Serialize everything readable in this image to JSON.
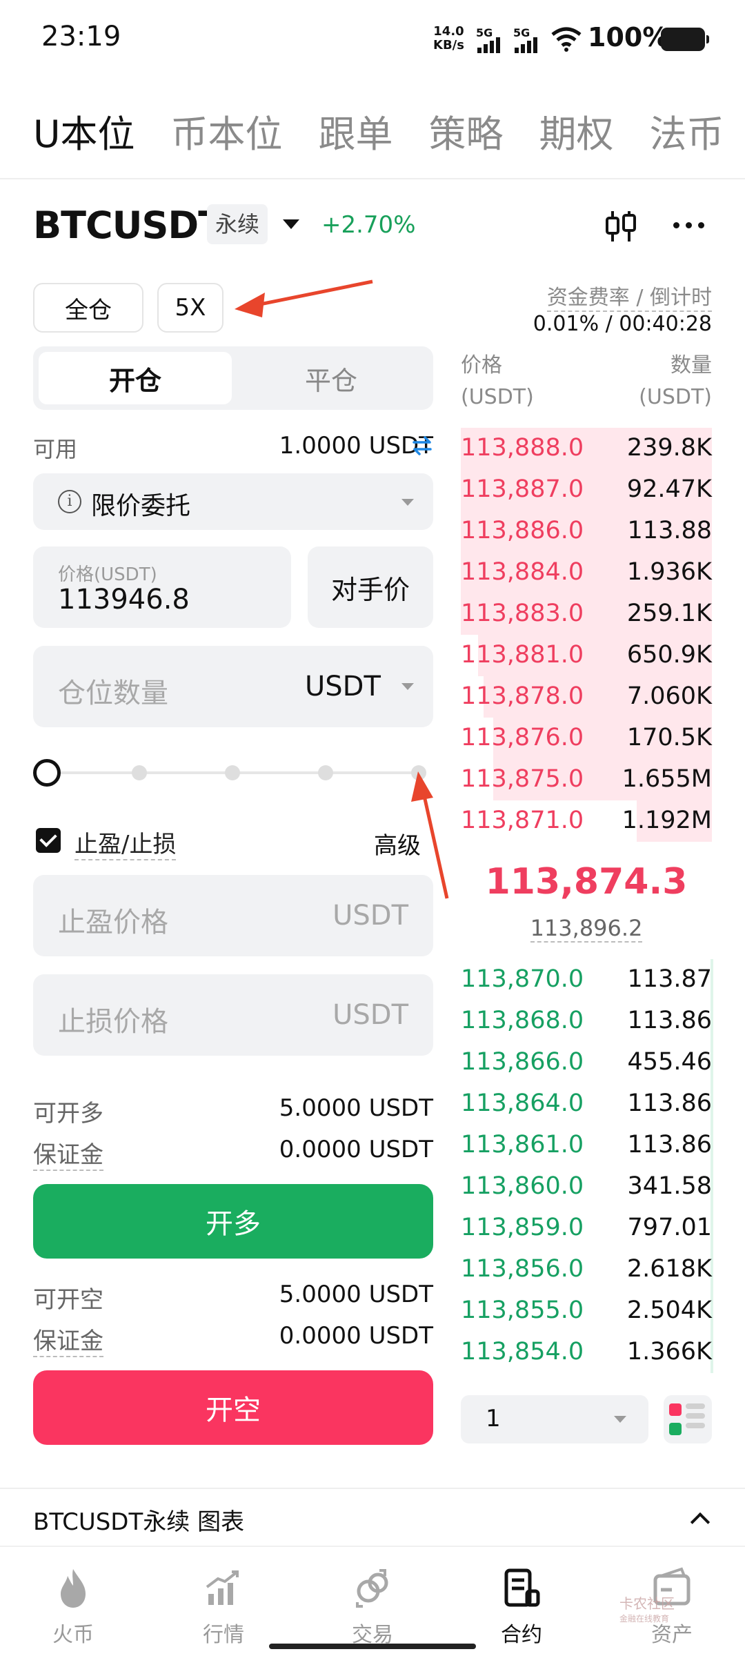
{
  "status_bar": {
    "time": "23:19",
    "net_speed": "14.0",
    "net_unit": "KB/s",
    "sim1": "5G",
    "sim2": "5G",
    "battery": "100%"
  },
  "top_tabs": [
    "U本位",
    "币本位",
    "跟单",
    "策略",
    "期权",
    "法币"
  ],
  "pair": {
    "symbol": "BTCUSDT",
    "type": "永续",
    "change": "+2.70%"
  },
  "margin": {
    "mode": "全仓",
    "leverage": "5X"
  },
  "funding": {
    "label": "资金费率 / 倒计时",
    "value": "0.01% / 00:40:28"
  },
  "order_side": {
    "open": "开仓",
    "close": "平仓"
  },
  "available": {
    "label": "可用",
    "value": "1.0000 USDT"
  },
  "order_type": "限价委托",
  "price": {
    "label": "价格(USDT)",
    "value": "113946.8",
    "counter": "对手价"
  },
  "quantity": {
    "placeholder": "仓位数量",
    "unit": "USDT"
  },
  "slider": {
    "value": 0
  },
  "tpsl": {
    "label": "止盈/止损",
    "checked": true,
    "advanced": "高级",
    "tp_placeholder": "止盈价格",
    "sl_placeholder": "止损价格",
    "unit": "USDT"
  },
  "long": {
    "max_label": "可开多",
    "max_value": "5.0000 USDT",
    "margin_label": "保证金",
    "margin_value": "0.0000 USDT",
    "button": "开多"
  },
  "short": {
    "max_label": "可开空",
    "max_value": "5.0000 USDT",
    "margin_label": "保证金",
    "margin_value": "0.0000 USDT",
    "button": "开空"
  },
  "orderbook": {
    "price_header": "价格",
    "qty_header": "数量",
    "price_unit": "(USDT)",
    "qty_unit": "(USDT)",
    "asks": [
      {
        "price": "113,888.0",
        "qty": "239.8K",
        "depth": 1.0
      },
      {
        "price": "113,887.0",
        "qty": "92.47K",
        "depth": 1.0
      },
      {
        "price": "113,886.0",
        "qty": "113.88",
        "depth": 1.0
      },
      {
        "price": "113,884.0",
        "qty": "1.936K",
        "depth": 1.0
      },
      {
        "price": "113,883.0",
        "qty": "259.1K",
        "depth": 1.0
      },
      {
        "price": "113,881.0",
        "qty": "650.9K",
        "depth": 0.93
      },
      {
        "price": "113,878.0",
        "qty": "7.060K",
        "depth": 0.91
      },
      {
        "price": "113,876.0",
        "qty": "170.5K",
        "depth": 0.87
      },
      {
        "price": "113,875.0",
        "qty": "1.655M",
        "depth": 0.87
      },
      {
        "price": "113,871.0",
        "qty": "1.192M",
        "depth": 0.3
      }
    ],
    "mid_price": "113,874.3",
    "mark_price": "113,896.2",
    "bids": [
      {
        "price": "113,870.0",
        "qty": "113.87"
      },
      {
        "price": "113,868.0",
        "qty": "113.86"
      },
      {
        "price": "113,866.0",
        "qty": "455.46"
      },
      {
        "price": "113,864.0",
        "qty": "113.86"
      },
      {
        "price": "113,861.0",
        "qty": "113.86"
      },
      {
        "price": "113,860.0",
        "qty": "341.58"
      },
      {
        "price": "113,859.0",
        "qty": "797.01"
      },
      {
        "price": "113,856.0",
        "qty": "2.618K"
      },
      {
        "price": "113,855.0",
        "qty": "2.504K"
      },
      {
        "price": "113,854.0",
        "qty": "1.366K"
      }
    ],
    "depth_step": "1"
  },
  "chart_bar": "BTCUSDT永续 图表",
  "bottom_nav": [
    {
      "label": "火币",
      "icon": "flame-icon"
    },
    {
      "label": "行情",
      "icon": "market-chart-icon"
    },
    {
      "label": "交易",
      "icon": "exchange-icon"
    },
    {
      "label": "合约",
      "icon": "contract-icon",
      "active": true
    },
    {
      "label": "资产",
      "icon": "wallet-icon"
    }
  ],
  "watermark": {
    "text": "卡农社区",
    "sub": "金融在线教育"
  },
  "colors": {
    "buy": "#1aad5f",
    "sell": "#fa3560",
    "ask_text": "#ef3e5f",
    "bid_text": "#16a062",
    "annotation_arrow": "#e8452c"
  }
}
